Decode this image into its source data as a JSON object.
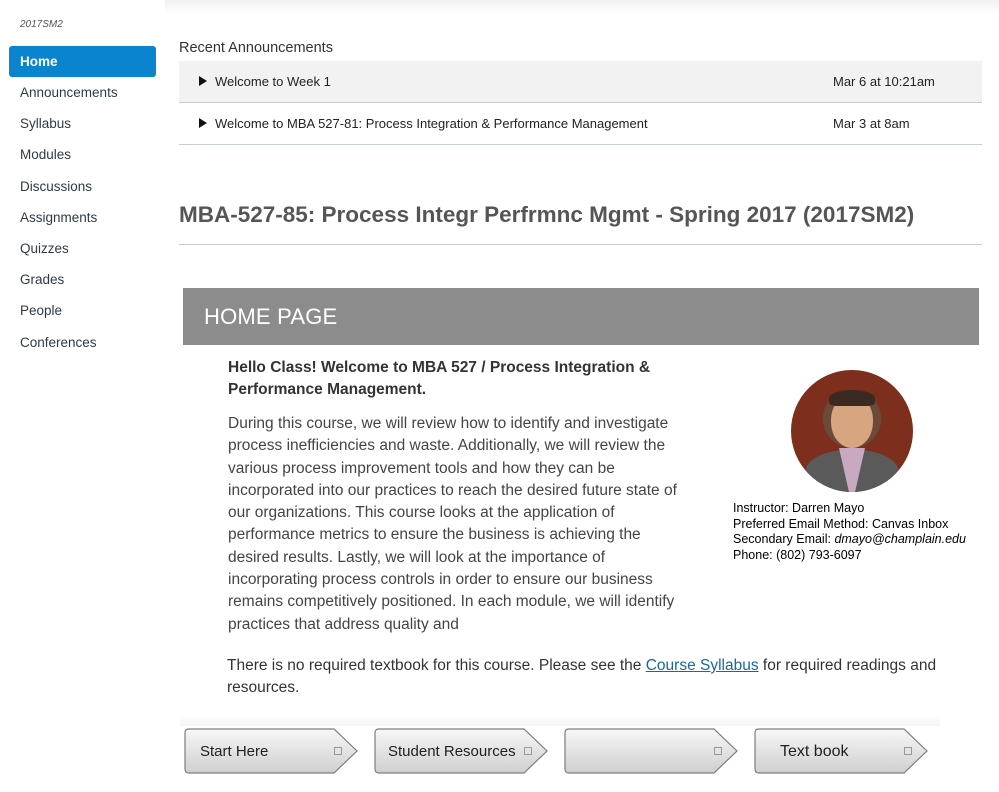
{
  "sidebar": {
    "term": "2017SM2",
    "items": [
      {
        "label": "Home",
        "active": true
      },
      {
        "label": "Announcements"
      },
      {
        "label": "Syllabus"
      },
      {
        "label": "Modules"
      },
      {
        "label": "Discussions"
      },
      {
        "label": "Assignments"
      },
      {
        "label": "Quizzes"
      },
      {
        "label": "Grades"
      },
      {
        "label": "People"
      },
      {
        "label": "Conferences"
      }
    ]
  },
  "announcements": {
    "title": "Recent Announcements",
    "items": [
      {
        "title": "Welcome to Week 1",
        "date": "Mar 6 at 10:21am"
      },
      {
        "title": "Welcome to MBA 527-81: Process Integration & Performance Management",
        "date": "Mar 3 at 8am"
      }
    ]
  },
  "course": {
    "title": "MBA-527-85: Process Integr Perfrmnc Mgmt - Spring 2017 (2017SM2)"
  },
  "home": {
    "banner": "HOME PAGE",
    "hello": "Hello Class! Welcome to MBA 527 / Process Integration & Performance Management.",
    "body": "During this course, we will review how to identify and investigate process inefficiencies and waste. Additionally, we will review the various process improvement tools and how they can be incorporated into our practices to reach the desired future state of our organizations.   This course looks at the application of performance metrics to ensure the business is achieving the desired results. Lastly, we will look at the importance of incorporating process controls in order to ensure our business remains competitively positioned. In each module, we will identify practices that address quality and",
    "instructor": {
      "name_line": "Instructor: Darren Mayo",
      "email_method_line": "Preferred Email Method: Canvas Inbox",
      "secondary_label": "Secondary Email: ",
      "secondary_email": "dmayo@champlain.edu",
      "phone_line": "Phone: (802) 793-6097"
    },
    "textbook_before": "There is no required textbook for this course. Please see the ",
    "textbook_link": "Course Syllabus",
    "textbook_after": " for required readings and resources.",
    "buttons": [
      {
        "label": "Start Here"
      },
      {
        "label": "Student Resources"
      },
      {
        "label": ""
      },
      {
        "label": "Text book"
      }
    ]
  },
  "colors": {
    "active_nav": "#0a84ce",
    "banner": "#8c8c8c",
    "link": "#1567a8"
  }
}
